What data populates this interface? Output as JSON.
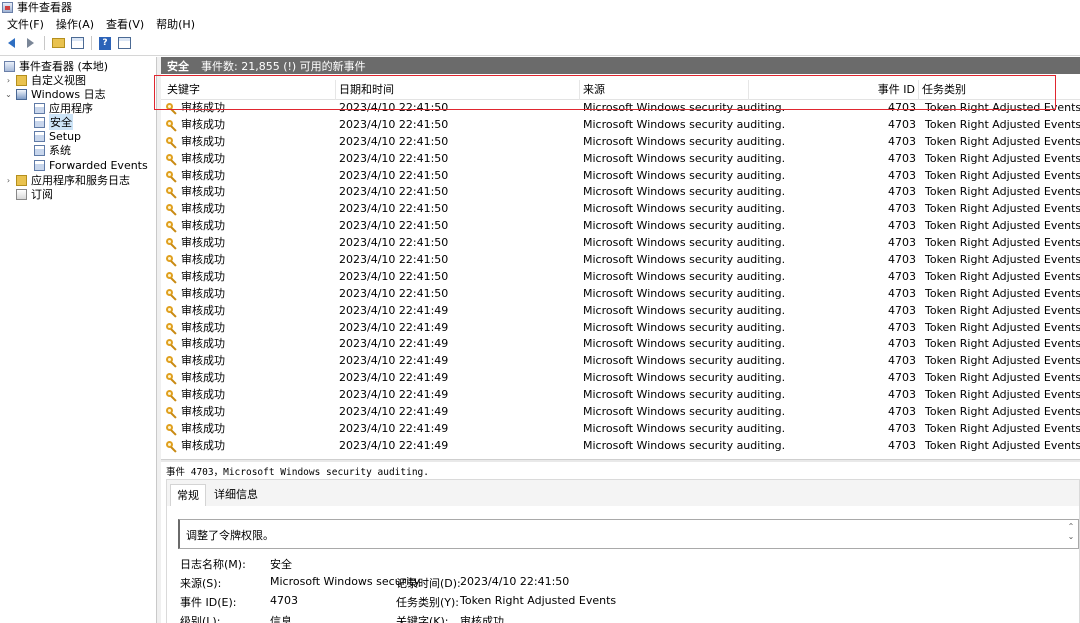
{
  "window": {
    "title": "事件查看器"
  },
  "menu": [
    "文件(F)",
    "操作(A)",
    "查看(V)",
    "帮助(H)"
  ],
  "toolbar": {
    "icons": [
      "back-arrow-icon",
      "forward-arrow-icon",
      "open-folder-icon",
      "console-tree-icon",
      "help-icon",
      "action-pane-icon"
    ],
    "help_glyph": "?"
  },
  "nav": {
    "root": "事件查看器 (本地)",
    "custom_views": "自定义视图",
    "windows_logs": "Windows 日志",
    "logs": [
      "应用程序",
      "安全",
      "Setup",
      "系统",
      "Forwarded Events"
    ],
    "selected_log": "安全",
    "apps_services": "应用程序和服务日志",
    "subscriptions": "订阅",
    "expand_glyph": "›",
    "collapse_glyph": "⌄"
  },
  "main_header": {
    "title": "安全",
    "subtitle": "事件数: 21,855 (!) 可用的新事件"
  },
  "table": {
    "columns": [
      "关键字",
      "日期和时间",
      "来源",
      "事件 ID",
      "任务类别"
    ],
    "rows": [
      {
        "keyword": "审核成功",
        "datetime": "2023/4/10 22:41:50",
        "source": "Microsoft Windows security auditing.",
        "event_id": "4703",
        "category": "Token Right Adjusted Events"
      },
      {
        "keyword": "审核成功",
        "datetime": "2023/4/10 22:41:50",
        "source": "Microsoft Windows security auditing.",
        "event_id": "4703",
        "category": "Token Right Adjusted Events"
      },
      {
        "keyword": "审核成功",
        "datetime": "2023/4/10 22:41:50",
        "source": "Microsoft Windows security auditing.",
        "event_id": "4703",
        "category": "Token Right Adjusted Events"
      },
      {
        "keyword": "审核成功",
        "datetime": "2023/4/10 22:41:50",
        "source": "Microsoft Windows security auditing.",
        "event_id": "4703",
        "category": "Token Right Adjusted Events"
      },
      {
        "keyword": "审核成功",
        "datetime": "2023/4/10 22:41:50",
        "source": "Microsoft Windows security auditing.",
        "event_id": "4703",
        "category": "Token Right Adjusted Events"
      },
      {
        "keyword": "审核成功",
        "datetime": "2023/4/10 22:41:50",
        "source": "Microsoft Windows security auditing.",
        "event_id": "4703",
        "category": "Token Right Adjusted Events"
      },
      {
        "keyword": "审核成功",
        "datetime": "2023/4/10 22:41:50",
        "source": "Microsoft Windows security auditing.",
        "event_id": "4703",
        "category": "Token Right Adjusted Events"
      },
      {
        "keyword": "审核成功",
        "datetime": "2023/4/10 22:41:50",
        "source": "Microsoft Windows security auditing.",
        "event_id": "4703",
        "category": "Token Right Adjusted Events"
      },
      {
        "keyword": "审核成功",
        "datetime": "2023/4/10 22:41:50",
        "source": "Microsoft Windows security auditing.",
        "event_id": "4703",
        "category": "Token Right Adjusted Events"
      },
      {
        "keyword": "审核成功",
        "datetime": "2023/4/10 22:41:50",
        "source": "Microsoft Windows security auditing.",
        "event_id": "4703",
        "category": "Token Right Adjusted Events"
      },
      {
        "keyword": "审核成功",
        "datetime": "2023/4/10 22:41:50",
        "source": "Microsoft Windows security auditing.",
        "event_id": "4703",
        "category": "Token Right Adjusted Events"
      },
      {
        "keyword": "审核成功",
        "datetime": "2023/4/10 22:41:50",
        "source": "Microsoft Windows security auditing.",
        "event_id": "4703",
        "category": "Token Right Adjusted Events"
      },
      {
        "keyword": "审核成功",
        "datetime": "2023/4/10 22:41:49",
        "source": "Microsoft Windows security auditing.",
        "event_id": "4703",
        "category": "Token Right Adjusted Events"
      },
      {
        "keyword": "审核成功",
        "datetime": "2023/4/10 22:41:49",
        "source": "Microsoft Windows security auditing.",
        "event_id": "4703",
        "category": "Token Right Adjusted Events"
      },
      {
        "keyword": "审核成功",
        "datetime": "2023/4/10 22:41:49",
        "source": "Microsoft Windows security auditing.",
        "event_id": "4703",
        "category": "Token Right Adjusted Events"
      },
      {
        "keyword": "审核成功",
        "datetime": "2023/4/10 22:41:49",
        "source": "Microsoft Windows security auditing.",
        "event_id": "4703",
        "category": "Token Right Adjusted Events"
      },
      {
        "keyword": "审核成功",
        "datetime": "2023/4/10 22:41:49",
        "source": "Microsoft Windows security auditing.",
        "event_id": "4703",
        "category": "Token Right Adjusted Events"
      },
      {
        "keyword": "审核成功",
        "datetime": "2023/4/10 22:41:49",
        "source": "Microsoft Windows security auditing.",
        "event_id": "4703",
        "category": "Token Right Adjusted Events"
      },
      {
        "keyword": "审核成功",
        "datetime": "2023/4/10 22:41:49",
        "source": "Microsoft Windows security auditing.",
        "event_id": "4703",
        "category": "Token Right Adjusted Events"
      },
      {
        "keyword": "审核成功",
        "datetime": "2023/4/10 22:41:49",
        "source": "Microsoft Windows security auditing.",
        "event_id": "4703",
        "category": "Token Right Adjusted Events"
      },
      {
        "keyword": "审核成功",
        "datetime": "2023/4/10 22:41:49",
        "source": "Microsoft Windows security auditing.",
        "event_id": "4703",
        "category": "Token Right Adjusted Events"
      }
    ]
  },
  "details": {
    "title": "事件 4703，Microsoft Windows security auditing.",
    "tabs": [
      "常规",
      "详细信息"
    ],
    "description": "调整了令牌权限。",
    "scroll_up_glyph": "⌃",
    "scroll_down_glyph": "⌄",
    "props": {
      "log_name_label": "日志名称(M):",
      "log_name": "安全",
      "source_label": "来源(S):",
      "source": "Microsoft Windows security",
      "logged_label": "记录时间(D):",
      "logged": "2023/4/10 22:41:50",
      "event_id_label": "事件 ID(E):",
      "event_id": "4703",
      "task_label": "任务类别(Y):",
      "task": "Token Right Adjusted Events",
      "level_label": "级别(L):",
      "level": "信息",
      "keywords_label": "关键字(K):",
      "keywords": "审核成功"
    }
  },
  "colors": {
    "header_bg": "#6b6b6b",
    "highlight_border": "#e0262f",
    "selection": "#cde4f7"
  }
}
